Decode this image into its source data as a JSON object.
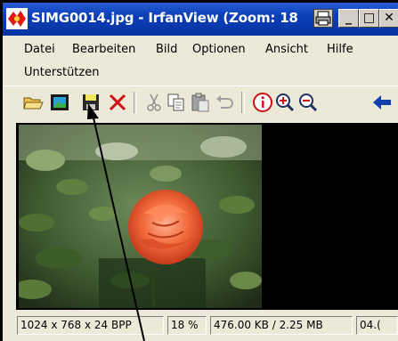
{
  "window": {
    "title": "SIMG0014.jpg - IrfanView (Zoom: 18",
    "controls": {
      "minimize": "_",
      "maximize": "□"
    }
  },
  "menu": {
    "items": [
      "Datei",
      "Bearbeiten",
      "Bild",
      "Optionen",
      "Ansicht",
      "Hilfe",
      "Unterstützen"
    ]
  },
  "toolbar": {
    "icons": [
      "open-folder-icon",
      "slideshow-icon",
      "save-icon",
      "delete-icon",
      "cut-icon",
      "copy-icon",
      "paste-icon",
      "undo-icon",
      "info-icon",
      "zoom-in-icon",
      "zoom-out-icon",
      "previous-arrow-icon"
    ]
  },
  "status": {
    "dimensions": "1024 x 768 x 24 BPP",
    "zoom": "18 %",
    "size": "476.00 KB / 2.25 MB",
    "extra": "04.("
  },
  "colors": {
    "titlebar": "#0a3fb8",
    "chrome": "#ece9d8",
    "canvas": "#000000"
  }
}
